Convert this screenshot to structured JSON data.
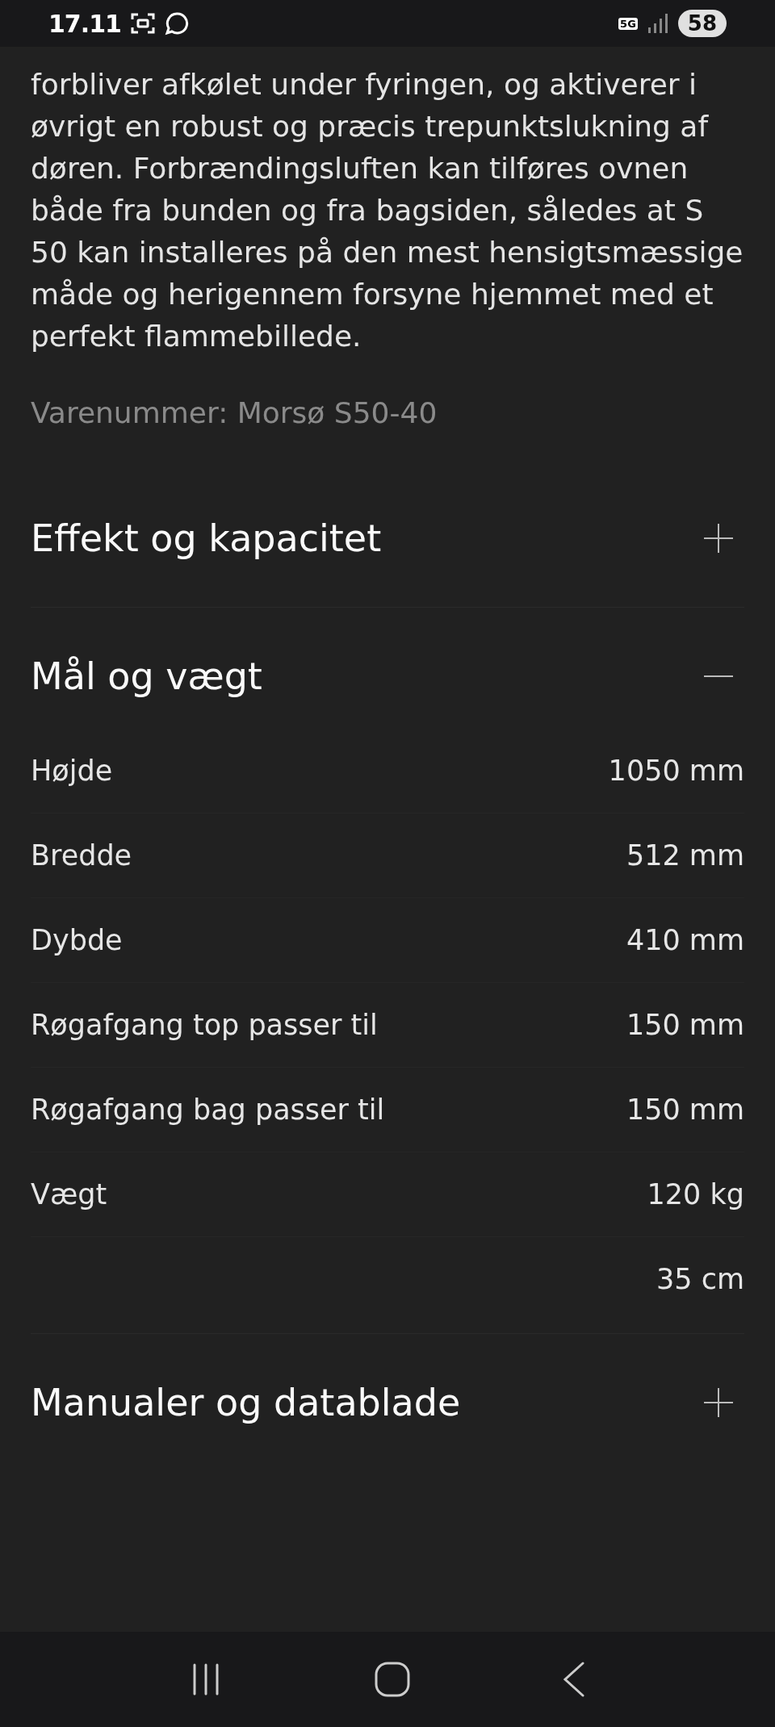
{
  "status_bar": {
    "time": "17.11",
    "network": "5G",
    "battery": "58"
  },
  "description": "forbliver afkølet under fyringen, og aktiverer i øvrigt en robust og præcis trepunktslukning af døren. Forbrændingsluften kan tilføres ovnen både fra bunden og fra bagsiden, således at S 50 kan installeres på den mest hensigtsmæssige måde og herigennem forsyne hjemmet med et perfekt flammebillede.",
  "item_number": "Varenummer: Morsø S50-40",
  "sections": [
    {
      "title": "Effekt og kapacitet",
      "expanded": false
    },
    {
      "title": "Mål og vægt",
      "expanded": true,
      "rows": [
        {
          "label": "Højde",
          "value": "1050 mm"
        },
        {
          "label": "Bredde",
          "value": "512 mm"
        },
        {
          "label": "Dybde",
          "value": "410 mm"
        },
        {
          "label": "Røgafgang top passer til",
          "value": "150 mm"
        },
        {
          "label": "Røgafgang bag passer til",
          "value": "150 mm"
        },
        {
          "label": "Vægt",
          "value": "120 kg"
        },
        {
          "value": "35 cm"
        }
      ]
    },
    {
      "title": "Manualer og datablade",
      "expanded": false
    }
  ]
}
